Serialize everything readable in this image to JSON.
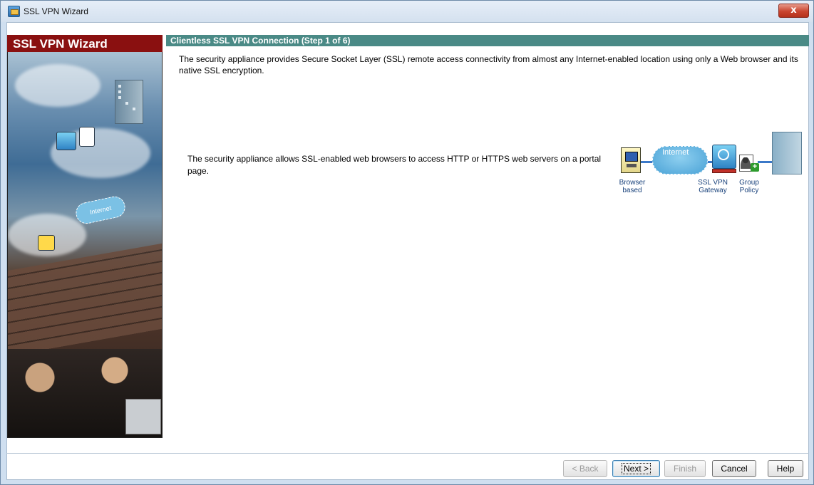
{
  "window": {
    "title": "SSL VPN Wizard",
    "close_symbol": "x"
  },
  "banner": {
    "title": "SSL VPN Wizard",
    "internet_label": "Internet"
  },
  "step": {
    "header": "Clientless SSL VPN Connection  (Step 1 of 6)",
    "intro": "The security appliance provides Secure Socket Layer (SSL) remote access connectivity from almost any Internet-enabled location using only a Web browser and its native SSL encryption.",
    "description": "The security appliance allows SSL-enabled web browsers to access HTTP or HTTPS web servers on a portal page."
  },
  "diagram": {
    "internet_label": "Internet",
    "browser_label_1": "Browser",
    "browser_label_2": "based",
    "gateway_label_1": "SSL VPN",
    "gateway_label_2": "Gateway",
    "policy_label_1": "Group",
    "policy_label_2": "Policy"
  },
  "buttons": {
    "back": "< Back",
    "next": "Next >",
    "finish": "Finish",
    "cancel": "Cancel",
    "help": "Help"
  },
  "colors": {
    "banner_red": "#8a1010",
    "section_teal": "#4a8a86",
    "close_red": "#c9452f"
  }
}
